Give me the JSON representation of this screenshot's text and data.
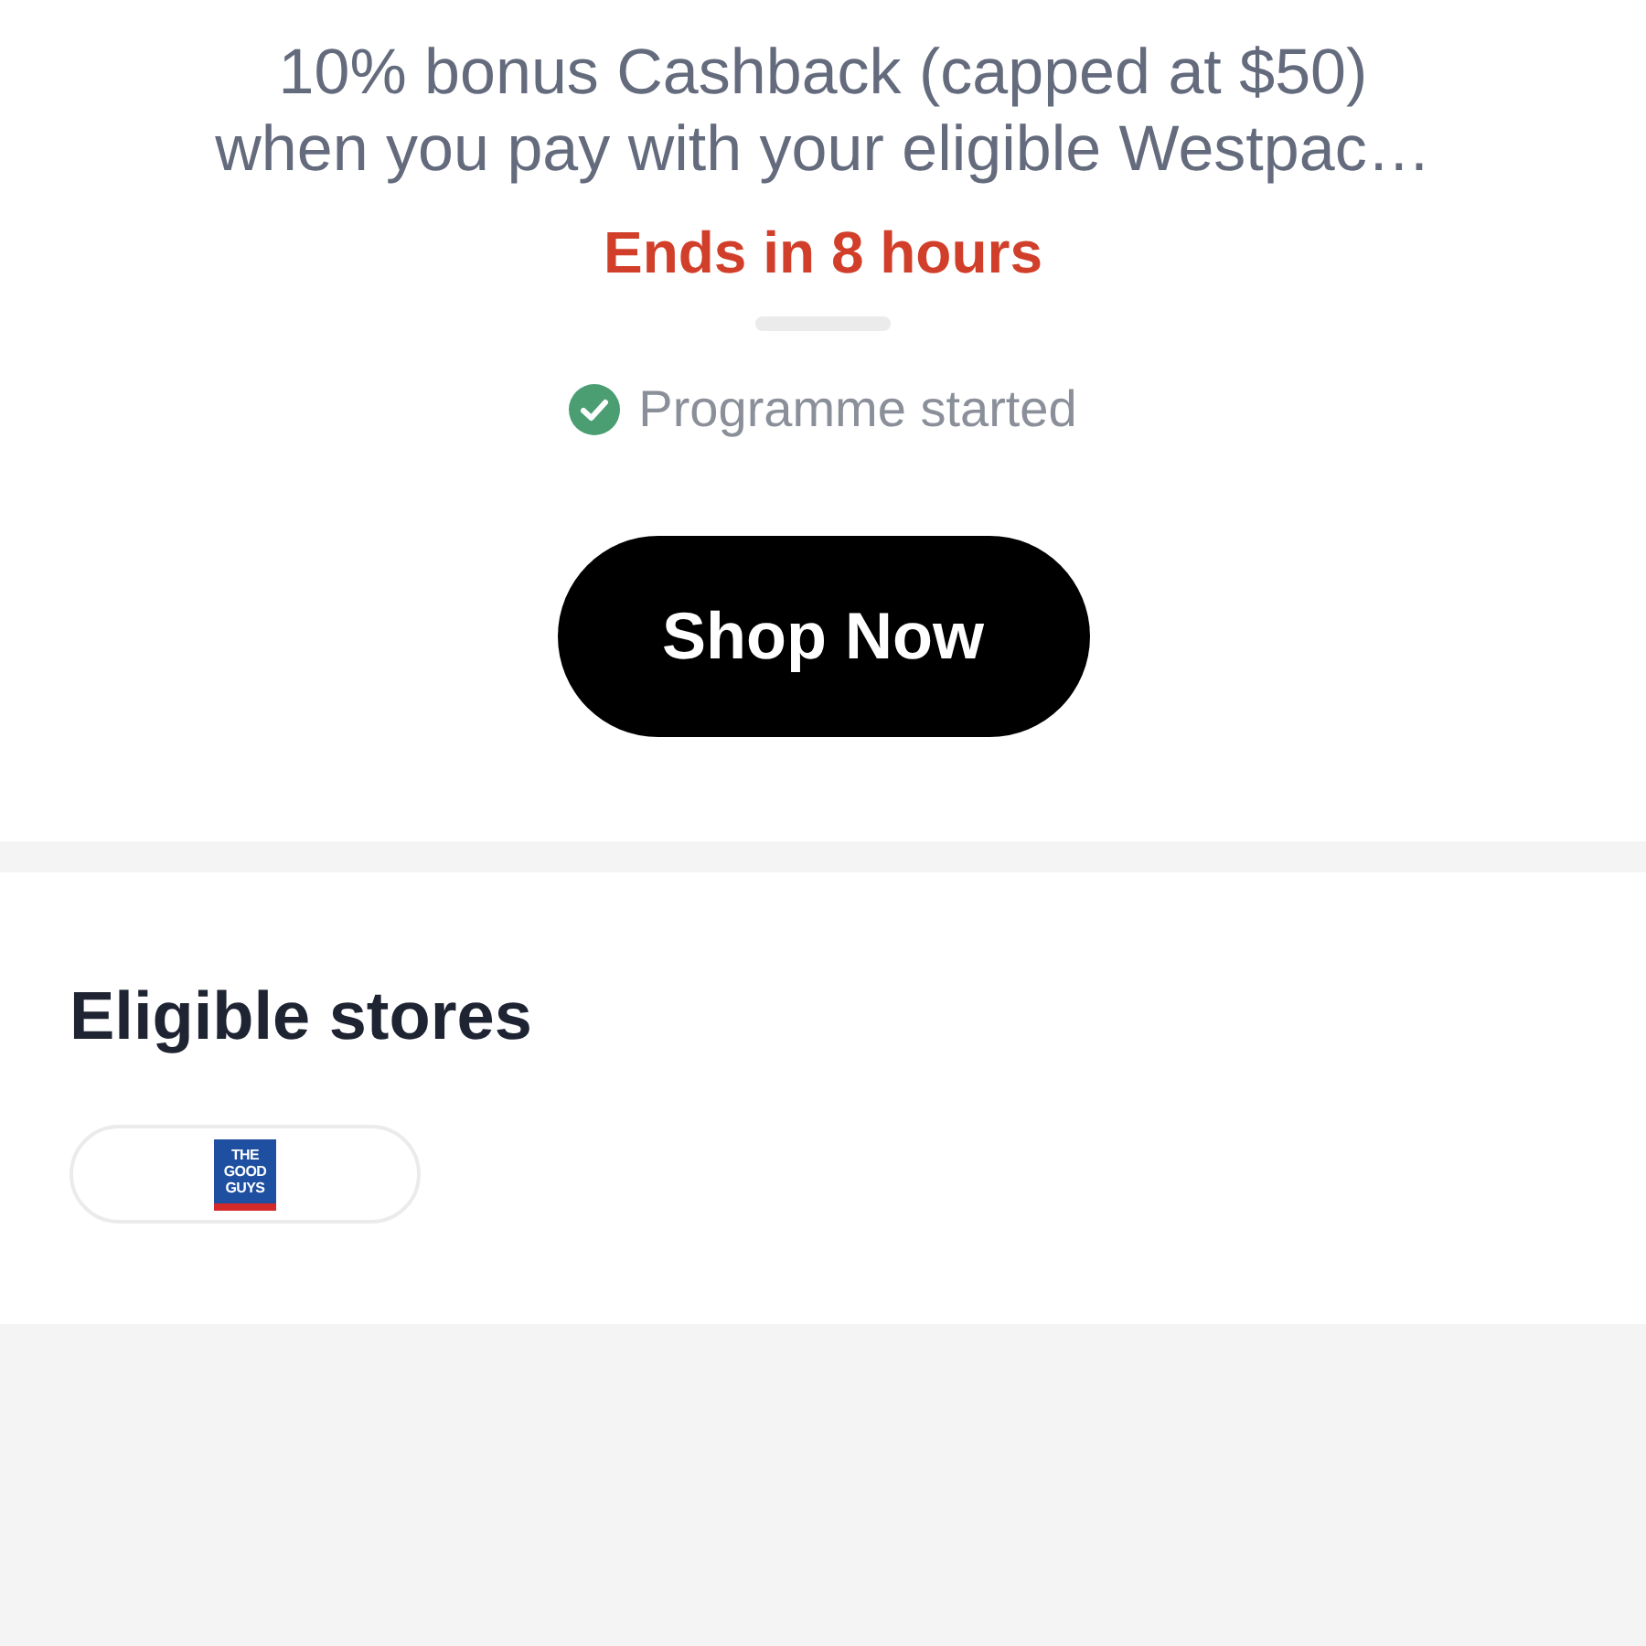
{
  "offer": {
    "description": "10% bonus Cashback (capped at $50)\nwhen you pay with your eligible Westpac…",
    "countdown": "Ends in 8 hours",
    "status": {
      "text": "Programme started",
      "started": true
    },
    "button": "Shop Now"
  },
  "eligible_stores": {
    "title": "Eligible stores",
    "stores": [
      {
        "logo_lines": [
          "THE",
          "GOOD",
          "GUYS"
        ]
      }
    ]
  }
}
